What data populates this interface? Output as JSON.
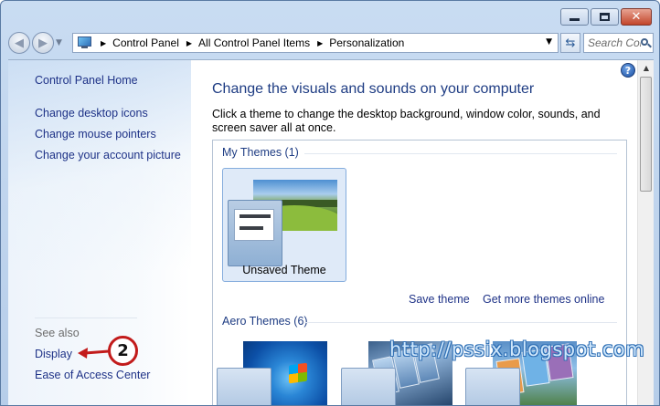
{
  "window": {
    "caption_buttons": [
      "minimize",
      "maximize",
      "close"
    ]
  },
  "navigation": {
    "breadcrumbs": [
      "Control Panel",
      "All Control Panel Items",
      "Personalization"
    ],
    "search_placeholder": "Search Con..."
  },
  "left_pane": {
    "home_link": "Control Panel Home",
    "tasks": [
      "Change desktop icons",
      "Change mouse pointers",
      "Change your account picture"
    ],
    "see_also_label": "See also",
    "see_also_links": [
      "Display",
      "Ease of Access Center"
    ]
  },
  "main": {
    "heading": "Change the visuals and sounds on your computer",
    "intro": "Click a theme to change the desktop background, window color, sounds, and screen saver all at once.",
    "my_themes": {
      "title": "My Themes (1)",
      "themes": [
        {
          "name": "Unsaved Theme",
          "selected": true
        }
      ]
    },
    "save_theme_link": "Save theme",
    "get_more_link": "Get more themes online",
    "aero_themes": {
      "title": "Aero Themes (6)"
    }
  },
  "annotations": {
    "step_number": "2",
    "watermark": "http://pssix.blogspot.com",
    "arrow_color": "#c21b1b"
  },
  "colors": {
    "link": "#1e3287",
    "heading": "#1e3c83",
    "selected_tile": "#dfeaf8"
  },
  "icons": [
    "back-arrow-icon",
    "forward-arrow-icon",
    "control-panel-icon",
    "refresh-icon",
    "search-icon",
    "help-icon"
  ]
}
